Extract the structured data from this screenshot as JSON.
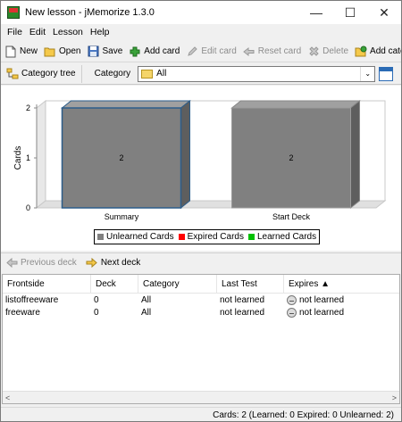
{
  "window": {
    "title": "New lesson - jMemorize 1.3.0",
    "minimize": "—",
    "maximize": "☐",
    "close": "✕"
  },
  "menu": [
    "File",
    "Edit",
    "Lesson",
    "Help"
  ],
  "toolbar": {
    "new": "New",
    "open": "Open",
    "save": "Save",
    "add_card": "Add card",
    "edit_card": "Edit card",
    "reset_card": "Reset card",
    "delete": "Delete",
    "add_category": "Add category"
  },
  "category_bar": {
    "tree_button": "Category tree",
    "label": "Category",
    "selected": "All",
    "arrow": "⌄"
  },
  "chart_data": {
    "type": "bar",
    "categories": [
      "Summary",
      "Start Deck"
    ],
    "values": [
      2,
      2
    ],
    "data_labels": [
      "2",
      "2"
    ],
    "ylabel": "Cards",
    "yticks": [
      "0",
      "1",
      "2"
    ],
    "ylim": [
      0,
      2
    ],
    "grid": false,
    "legend_position": "bottom",
    "legend": [
      {
        "name": "Unlearned Cards",
        "color": "#808080"
      },
      {
        "name": "Expired Cards",
        "color": "#ff0000"
      },
      {
        "name": "Learned Cards",
        "color": "#00c000"
      }
    ]
  },
  "deck_nav": {
    "previous": "Previous deck",
    "next": "Next deck"
  },
  "table": {
    "columns": [
      "Frontside",
      "Deck",
      "Category",
      "Last Test",
      "Expires ▲"
    ],
    "rows": [
      {
        "frontside": "listoffreeware",
        "deck": "0",
        "category": "All",
        "last_test": "not learned",
        "expires": "not learned"
      },
      {
        "frontside": "freeware",
        "deck": "0",
        "category": "All",
        "last_test": "not learned",
        "expires": "not learned"
      }
    ],
    "scroll_left": "<",
    "scroll_right": ">"
  },
  "status": {
    "text": "Cards: 2 (Learned: 0  Expired: 0  Unlearned: 2)"
  }
}
